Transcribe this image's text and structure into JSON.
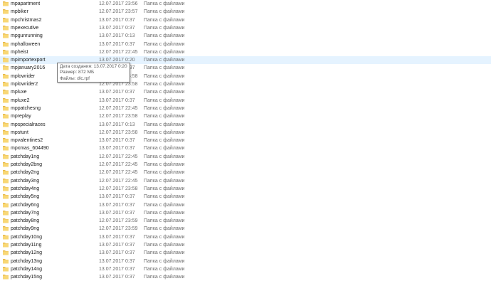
{
  "colors": {
    "folder_body": "#f8d775",
    "folder_tab": "#e8b94a",
    "hover_row": "#e5f3ff",
    "date_text": "#6d6d6d"
  },
  "rows": [
    {
      "name": "mpapartment",
      "date": "12.07.2017 23:56",
      "type": "Папка с файлами",
      "icon": "folder-icon"
    },
    {
      "name": "mpbiker",
      "date": "12.07.2017 23:57",
      "type": "Папка с файлами",
      "icon": "folder-icon"
    },
    {
      "name": "mpchristmas2",
      "date": "13.07.2017 0:37",
      "type": "Папка с файлами",
      "icon": "folder-icon"
    },
    {
      "name": "mpexecutive",
      "date": "13.07.2017 0:37",
      "type": "Папка с файлами",
      "icon": "folder-icon"
    },
    {
      "name": "mpgunrunning",
      "date": "13.07.2017 0:13",
      "type": "Папка с файлами",
      "icon": "folder-icon"
    },
    {
      "name": "mphalloween",
      "date": "13.07.2017 0:37",
      "type": "Папка с файлами",
      "icon": "folder-icon"
    },
    {
      "name": "mpheist",
      "date": "12.07.2017 22:45",
      "type": "Папка с файлами",
      "icon": "folder-icon"
    },
    {
      "name": "mpimportexport",
      "date": "13.07.2017 0:20",
      "type": "Папка с файлами",
      "icon": "folder-icon",
      "hovered": true
    },
    {
      "name": "mpjanuary2016",
      "date": "13.07.2017 0:37",
      "type": "Папка с файлами",
      "icon": "folder-icon"
    },
    {
      "name": "mplowrider",
      "date": "12.07.2017 23:58",
      "type": "Папка с файлами",
      "icon": "folder-icon"
    },
    {
      "name": "mplowrider2",
      "date": "12.07.2017 23:58",
      "type": "Папка с файлами",
      "icon": "folder-icon"
    },
    {
      "name": "mpluxe",
      "date": "13.07.2017 0:37",
      "type": "Папка с файлами",
      "icon": "folder-icon"
    },
    {
      "name": "mpluxe2",
      "date": "13.07.2017 0:37",
      "type": "Папка с файлами",
      "icon": "folder-icon"
    },
    {
      "name": "mppatchesng",
      "date": "12.07.2017 22:45",
      "type": "Папка с файлами",
      "icon": "folder-icon"
    },
    {
      "name": "mpreplay",
      "date": "12.07.2017 23:58",
      "type": "Папка с файлами",
      "icon": "folder-icon"
    },
    {
      "name": "mpspecialraces",
      "date": "13.07.2017 0:13",
      "type": "Папка с файлами",
      "icon": "folder-icon"
    },
    {
      "name": "mpstunt",
      "date": "12.07.2017 23:58",
      "type": "Папка с файлами",
      "icon": "folder-icon"
    },
    {
      "name": "mpvalentines2",
      "date": "13.07.2017 0:37",
      "type": "Папка с файлами",
      "icon": "folder-icon"
    },
    {
      "name": "mpxmas_604490",
      "date": "13.07.2017 0:37",
      "type": "Папка с файлами",
      "icon": "folder-icon"
    },
    {
      "name": "patchday1ng",
      "date": "12.07.2017 22:45",
      "type": "Папка с файлами",
      "icon": "folder-icon"
    },
    {
      "name": "patchday2bng",
      "date": "12.07.2017 22:45",
      "type": "Папка с файлами",
      "icon": "folder-icon"
    },
    {
      "name": "patchday2ng",
      "date": "12.07.2017 22:45",
      "type": "Папка с файлами",
      "icon": "folder-icon"
    },
    {
      "name": "patchday3ng",
      "date": "12.07.2017 22:45",
      "type": "Папка с файлами",
      "icon": "folder-icon"
    },
    {
      "name": "patchday4ng",
      "date": "12.07.2017 23:58",
      "type": "Папка с файлами",
      "icon": "folder-icon"
    },
    {
      "name": "patchday5ng",
      "date": "13.07.2017 0:37",
      "type": "Папка с файлами",
      "icon": "folder-icon"
    },
    {
      "name": "patchday6ng",
      "date": "13.07.2017 0:37",
      "type": "Папка с файлами",
      "icon": "folder-icon"
    },
    {
      "name": "patchday7ng",
      "date": "13.07.2017 0:37",
      "type": "Папка с файлами",
      "icon": "folder-icon"
    },
    {
      "name": "patchday8ng",
      "date": "12.07.2017 23:59",
      "type": "Папка с файлами",
      "icon": "folder-icon"
    },
    {
      "name": "patchday9ng",
      "date": "12.07.2017 23:59",
      "type": "Папка с файлами",
      "icon": "folder-icon"
    },
    {
      "name": "patchday10ng",
      "date": "13.07.2017 0:37",
      "type": "Папка с файлами",
      "icon": "folder-icon"
    },
    {
      "name": "patchday11ng",
      "date": "13.07.2017 0:37",
      "type": "Папка с файлами",
      "icon": "folder-icon"
    },
    {
      "name": "patchday12ng",
      "date": "13.07.2017 0:37",
      "type": "Папка с файлами",
      "icon": "folder-icon"
    },
    {
      "name": "patchday13ng",
      "date": "13.07.2017 0:37",
      "type": "Папка с файлами",
      "icon": "folder-icon"
    },
    {
      "name": "patchday14ng",
      "date": "13.07.2017 0:37",
      "type": "Папка с файлами",
      "icon": "folder-icon"
    },
    {
      "name": "patchday15ng",
      "date": "13.07.2017 0:37",
      "type": "Папка с файлами",
      "icon": "folder-icon"
    }
  ],
  "tooltip": {
    "created": "Дата создания: 13.07.2017 0:20",
    "size": "Размер: 872 МБ",
    "files": "Файлы: dlc.rpf"
  }
}
